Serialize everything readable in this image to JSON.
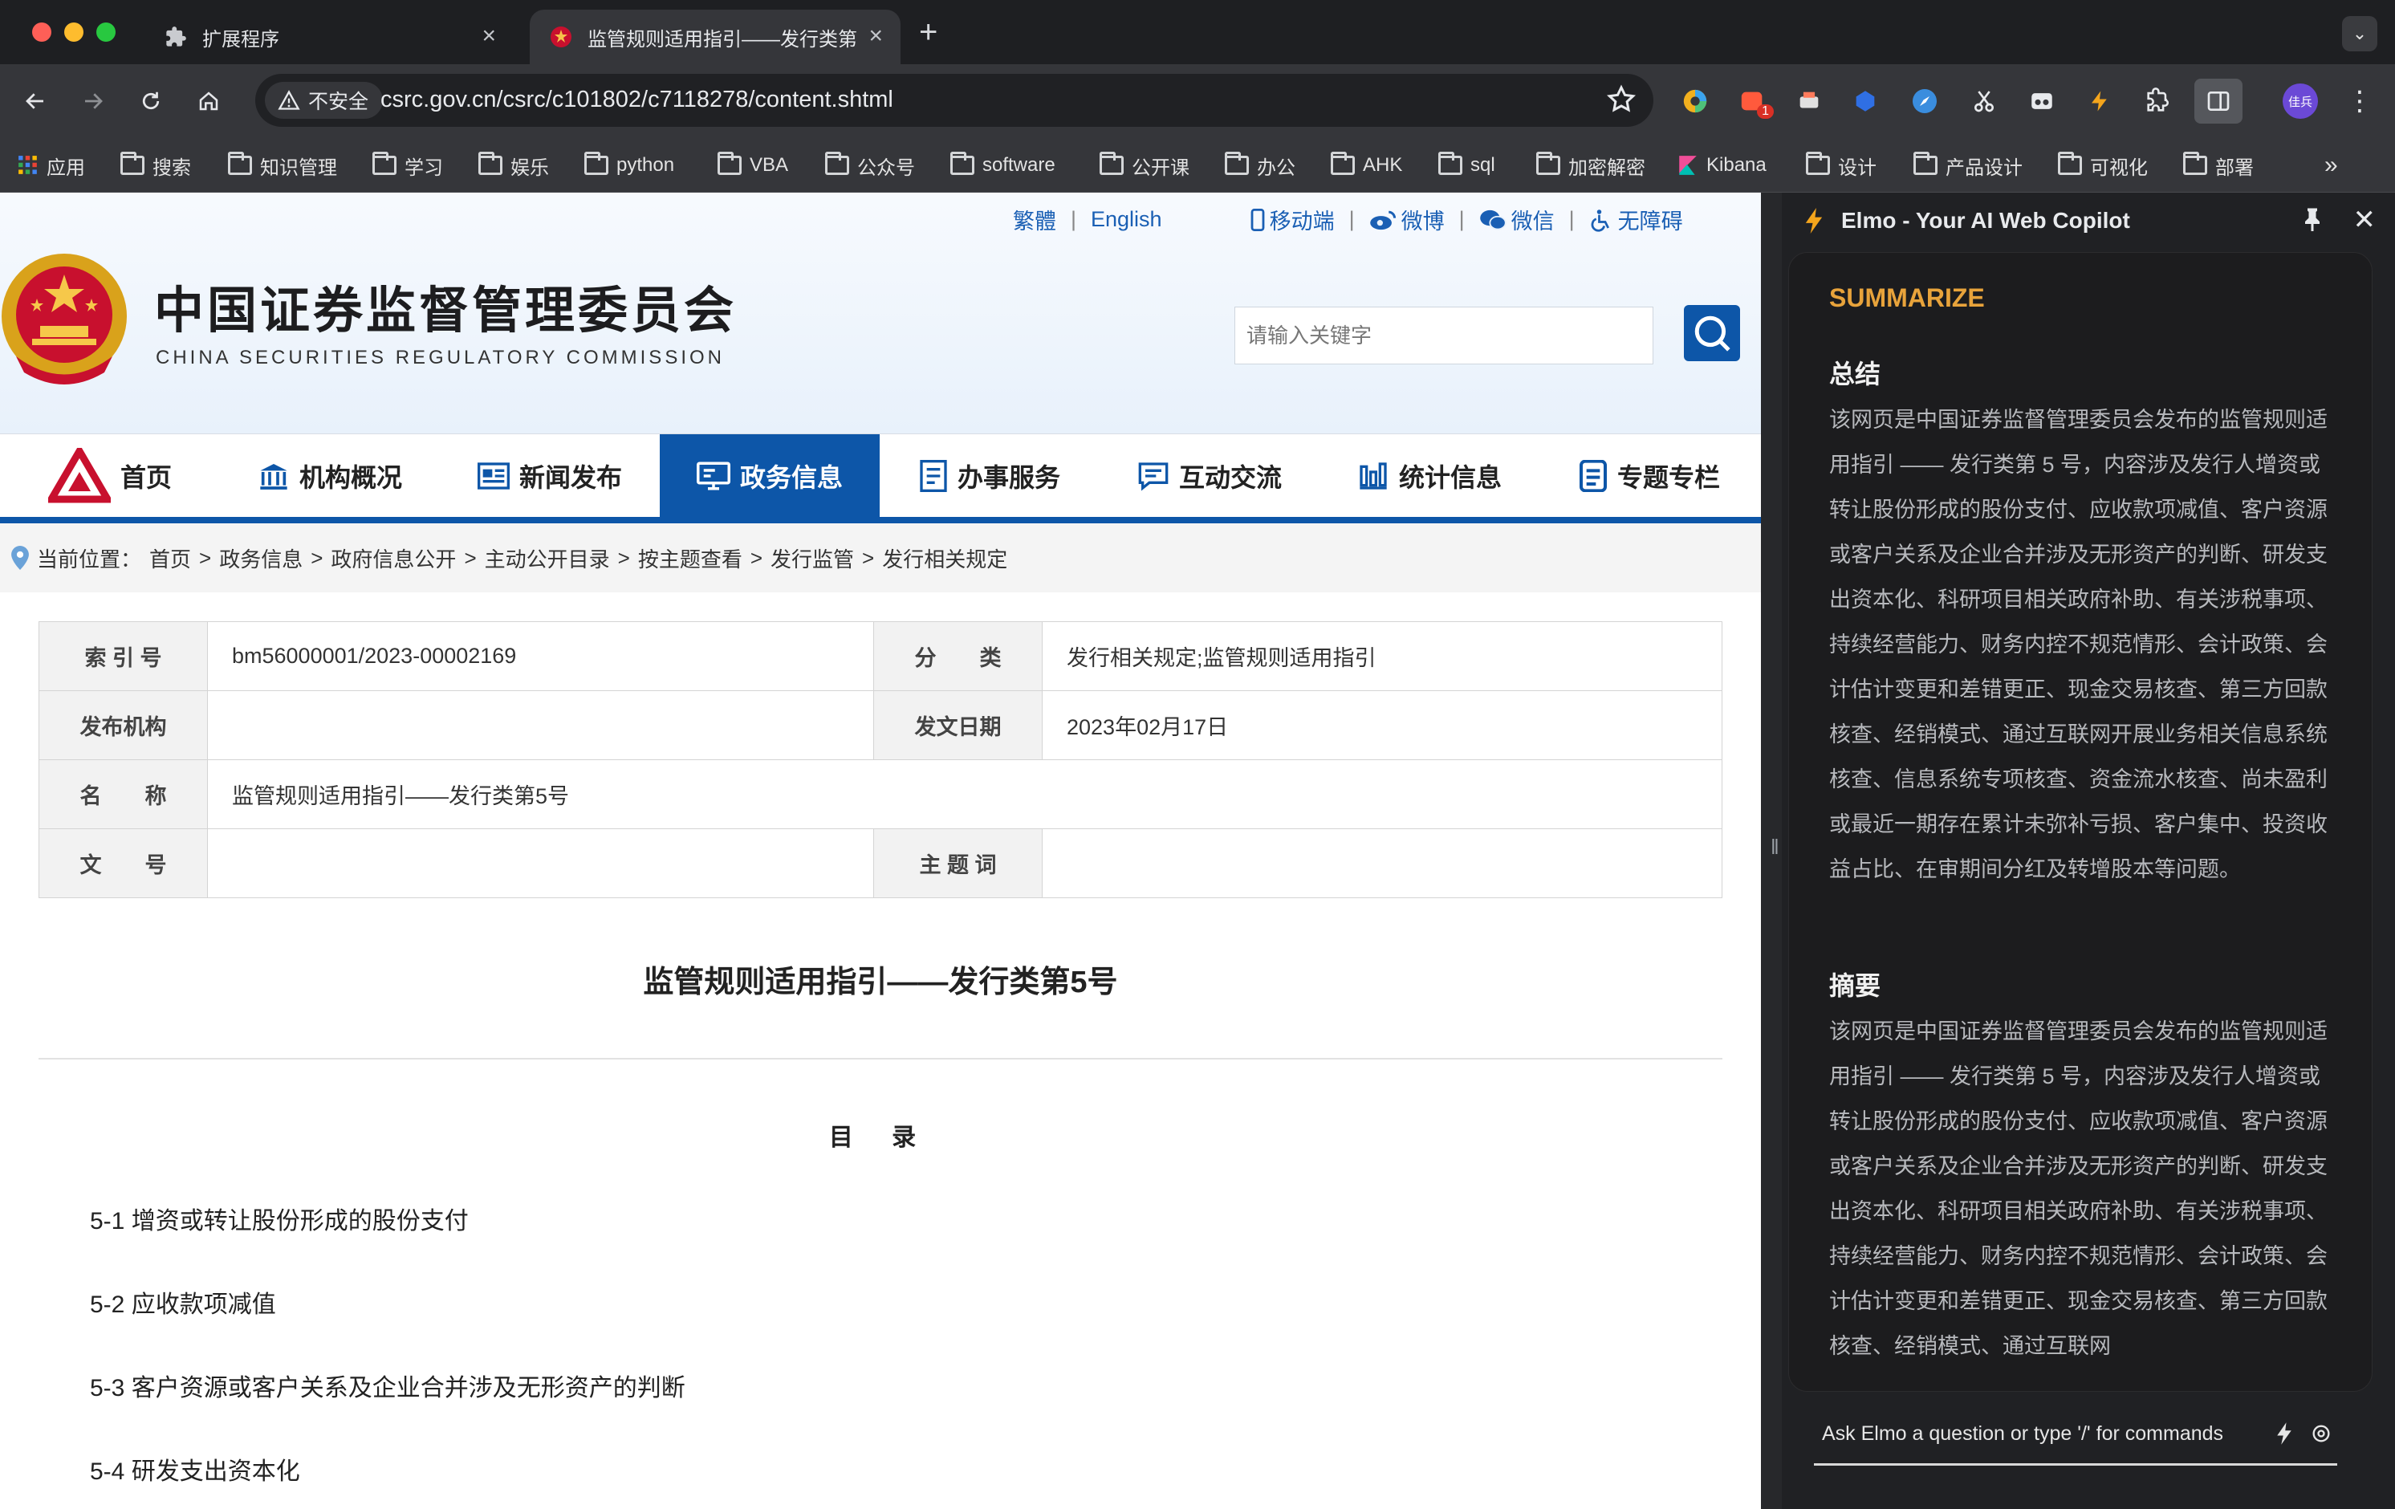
{
  "browser": {
    "tabs": [
      {
        "title": "扩展程序",
        "icon": "puzzle-icon"
      },
      {
        "title": "监管规则适用指引——发行类第",
        "icon": "csrc-favicon-icon",
        "active": true
      }
    ],
    "omnibox": {
      "security_label": "不安全",
      "url": "csrc.gov.cn/csrc/c101802/c7118278/content.shtml"
    },
    "profile_initials": "佳兵",
    "ext_badge": "1",
    "bookmarks": [
      {
        "label": "应用",
        "icon": "apps-grid-icon"
      },
      {
        "label": "搜索",
        "icon": "folder-icon"
      },
      {
        "label": "知识管理",
        "icon": "folder-icon"
      },
      {
        "label": "学习",
        "icon": "folder-icon"
      },
      {
        "label": "娱乐",
        "icon": "folder-icon"
      },
      {
        "label": "python",
        "icon": "folder-icon"
      },
      {
        "label": "VBA",
        "icon": "folder-icon"
      },
      {
        "label": "公众号",
        "icon": "folder-icon"
      },
      {
        "label": "software",
        "icon": "folder-icon"
      },
      {
        "label": "公开课",
        "icon": "folder-icon"
      },
      {
        "label": "办公",
        "icon": "folder-icon"
      },
      {
        "label": "AHK",
        "icon": "folder-icon"
      },
      {
        "label": "sql",
        "icon": "folder-icon"
      },
      {
        "label": "加密解密",
        "icon": "folder-icon"
      },
      {
        "label": "Kibana",
        "icon": "kibana-icon"
      },
      {
        "label": "设计",
        "icon": "folder-icon"
      },
      {
        "label": "产品设计",
        "icon": "folder-icon"
      },
      {
        "label": "可视化",
        "icon": "folder-icon"
      },
      {
        "label": "部署",
        "icon": "folder-icon"
      }
    ]
  },
  "site": {
    "title_cn": "中国证券监督管理委员会",
    "title_en": "CHINA SECURITIES REGULATORY COMMISSION",
    "top_links": {
      "traditional": "繁體",
      "english": "English",
      "mobile": "移动端",
      "weibo": "微博",
      "wechat": "微信",
      "accessibility": "无障碍"
    },
    "search_placeholder": "请输入关键字",
    "nav": [
      {
        "label": "首页",
        "icon": "csrc-logo-icon"
      },
      {
        "label": "机构概况",
        "icon": "building-icon"
      },
      {
        "label": "新闻发布",
        "icon": "newspaper-icon"
      },
      {
        "label": "政务信息",
        "icon": "monitor-icon",
        "active": true
      },
      {
        "label": "办事服务",
        "icon": "form-icon"
      },
      {
        "label": "互动交流",
        "icon": "chat-icon"
      },
      {
        "label": "统计信息",
        "icon": "bar-chart-icon"
      },
      {
        "label": "专题专栏",
        "icon": "document-icon"
      }
    ],
    "breadcrumb": {
      "prefix": "当前位置：",
      "items": [
        "首页",
        "政务信息",
        "政府信息公开",
        "主动公开目录",
        "按主题查看",
        "发行监管",
        "发行相关规定"
      ],
      "separator": ">"
    },
    "meta": {
      "index_label": "索 引 号",
      "index_value": "bm56000001/2023-00002169",
      "category_label": "分　　类",
      "category_value": "发行相关规定;监管规则适用指引",
      "publisher_label": "发布机构",
      "publisher_value": "",
      "date_label": "发文日期",
      "date_value": "2023年02月17日",
      "name_label": "名　　称",
      "name_value": "监管规则适用指引——发行类第5号",
      "docno_label": "文　　号",
      "docno_value": "",
      "keywords_label": "主 题 词",
      "keywords_value": ""
    },
    "doc_title": "监管规则适用指引——发行类第5号",
    "toc_heading": "目 录",
    "toc": [
      "5-1  增资或转让股份形成的股份支付",
      "5-2  应收款项减值",
      "5-3  客户资源或客户关系及企业合并涉及无形资产的判断",
      "5-4  研发支出资本化"
    ]
  },
  "copilot": {
    "title": "Elmo - Your AI Web Copilot",
    "action": "SUMMARIZE",
    "section1_title": "总结",
    "section1_text": "该网页是中国证券监督管理委员会发布的监管规则适用指引 —— 发行类第 5 号，内容涉及发行人增资或转让股份形成的股份支付、应收款项减值、客户资源或客户关系及企业合并涉及无形资产的判断、研发支出资本化、科研项目相关政府补助、有关涉税事项、持续经营能力、财务内控不规范情形、会计政策、会计估计变更和差错更正、现金交易核查、第三方回款核查、经销模式、通过互联网开展业务相关信息系统核查、信息系统专项核查、资金流水核查、尚未盈利或最近一期存在累计未弥补亏损、客户集中、投资收益占比、在审期间分红及转增股本等问题。",
    "section2_title": "摘要",
    "section2_text": "该网页是中国证券监督管理委员会发布的监管规则适用指引 —— 发行类第 5 号，内容涉及发行人增资或转让股份形成的股份支付、应收款项减值、客户资源或客户关系及企业合并涉及无形资产的判断、研发支出资本化、科研项目相关政府补助、有关涉税事项、持续经营能力、财务内控不规范情形、会计政策、会计估计变更和差错更正、现金交易核查、第三方回款核查、经销模式、通过互联网",
    "input_placeholder": "Ask Elmo a question or type '/' for commands"
  },
  "colors": {
    "csrc_blue": "#0d56a8",
    "elmo_orange": "#e8a33b",
    "chrome_dark": "#35363a"
  }
}
